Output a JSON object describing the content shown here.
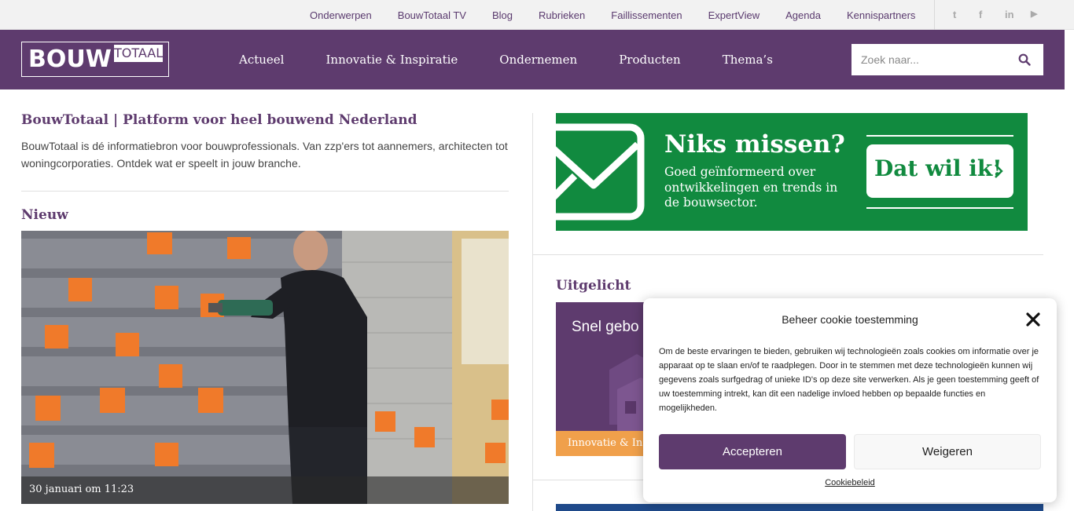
{
  "topbar": {
    "links": [
      "Onderwerpen",
      "BouwTotaal TV",
      "Blog",
      "Rubrieken",
      "Faillissementen",
      "ExpertView",
      "Agenda",
      "Kennispartners"
    ],
    "social": [
      {
        "icon": "twitter-icon",
        "glyph": "t"
      },
      {
        "icon": "facebook-icon",
        "glyph": "f"
      },
      {
        "icon": "linkedin-icon",
        "glyph": "in"
      },
      {
        "icon": "youtube-icon",
        "glyph": "▶"
      }
    ]
  },
  "header": {
    "logo_main": "BOUW",
    "logo_sub": "TOTAAL",
    "nav": [
      "Actueel",
      "Innovatie & Inspiratie",
      "Ondernemen",
      "Producten",
      "Thema’s"
    ],
    "search_placeholder": "Zoek naar..."
  },
  "intro": {
    "title": "BouwTotaal | Platform voor heel bouwend Nederland",
    "text": "BouwTotaal is dé informatiebron voor bouwprofessionals. Van zzp'ers tot aannemers, architecten tot woningcorporaties. Ontdek wat er speelt in jouw branche."
  },
  "nieuw": {
    "heading": "Nieuw",
    "date": "30 januari om 11:23"
  },
  "banner": {
    "headline": "Niks missen?",
    "subtext": "Goed geïnformeerd over ontwikkelingen en trends in de bouwsector.",
    "cta": "Dat wil ik!"
  },
  "uitgelicht": {
    "heading": "Uitgelicht",
    "title": "Snel gebo",
    "tag": "Innovatie & Ins"
  },
  "cookie": {
    "title": "Beheer cookie toestemming",
    "body": "Om de beste ervaringen te bieden, gebruiken wij technologieën zoals cookies om informatie over je apparaat op te slaan en/of te raadplegen. Door in te stemmen met deze technologieën kunnen wij gegevens zoals surfgedrag of unieke ID's op deze site verwerken. Als je geen toestemming geeft of uw toestemming intrekt, kan dit een nadelige invloed hebben op bepaalde functies en mogelijkheden.",
    "accept": "Accepteren",
    "deny": "Weigeren",
    "policy": "Cookiebeleid"
  },
  "colors": {
    "brand_purple": "#5e3b6e",
    "banner_green": "#118a3f",
    "tag_orange": "#f0a04b"
  }
}
